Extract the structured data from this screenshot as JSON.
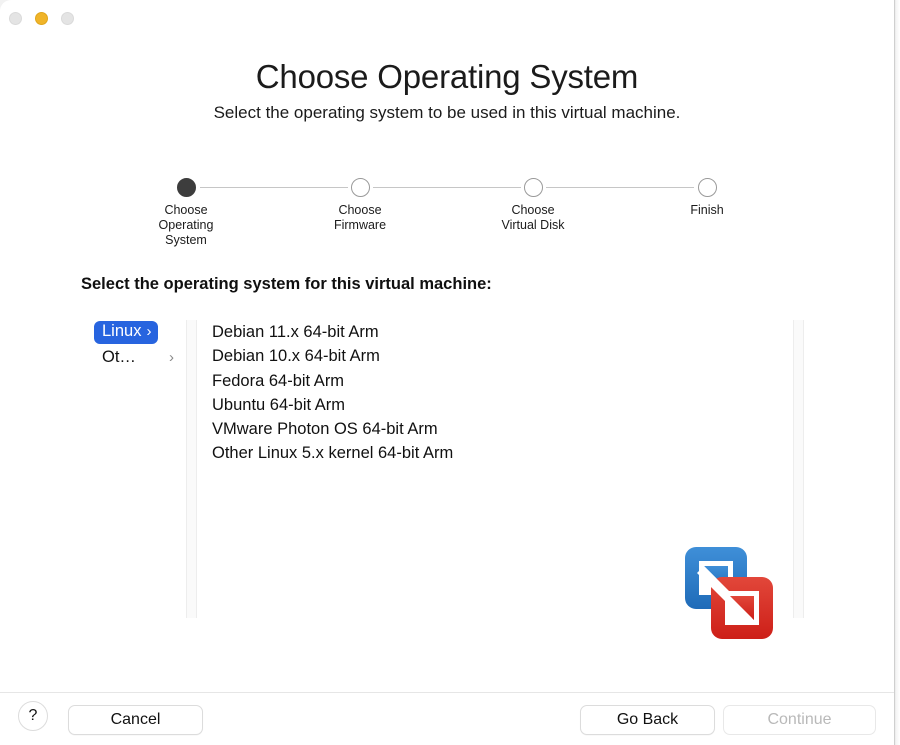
{
  "window": {
    "traffic_lights": [
      {
        "name": "close",
        "color": "#e4e4e4",
        "enabled": false
      },
      {
        "name": "minimize",
        "color": "#f0b429",
        "enabled": true
      },
      {
        "name": "zoom",
        "color": "#e4e4e4",
        "enabled": false
      }
    ]
  },
  "header": {
    "title": "Choose Operating System",
    "subtitle": "Select the operating system to be used in this virtual machine."
  },
  "steps": [
    {
      "label": "Choose\nOperating\nSystem",
      "state": "current"
    },
    {
      "label": "Choose\nFirmware",
      "state": "pending"
    },
    {
      "label": "Choose\nVirtual Disk",
      "state": "pending"
    },
    {
      "label": "Finish",
      "state": "pending"
    }
  ],
  "main": {
    "prompt": "Select the operating system for this virtual machine:",
    "categories": [
      {
        "label": "Linux",
        "chevron": "›",
        "selected": true
      },
      {
        "label": "Ot…",
        "chevron": "›",
        "selected": false
      }
    ],
    "os_list": [
      "Debian 11.x 64-bit Arm",
      "Debian 10.x 64-bit Arm",
      "Fedora 64-bit Arm",
      "Ubuntu 64-bit Arm",
      "VMware Photon OS 64-bit Arm",
      "Other Linux 5.x kernel 64-bit Arm"
    ],
    "logo": {
      "name": "vmware-fusion-logo",
      "blue": "#2378c8",
      "red": "#d6291f"
    }
  },
  "footer": {
    "help_label": "?",
    "cancel_label": "Cancel",
    "go_back_label": "Go Back",
    "continue_label": "Continue",
    "continue_enabled": false
  },
  "colors": {
    "accent": "#2764df",
    "step_current": "#3d3d3d",
    "step_pending_border": "#9a9a9a",
    "text": "#111111",
    "disabled_text": "#b9b9b9"
  }
}
